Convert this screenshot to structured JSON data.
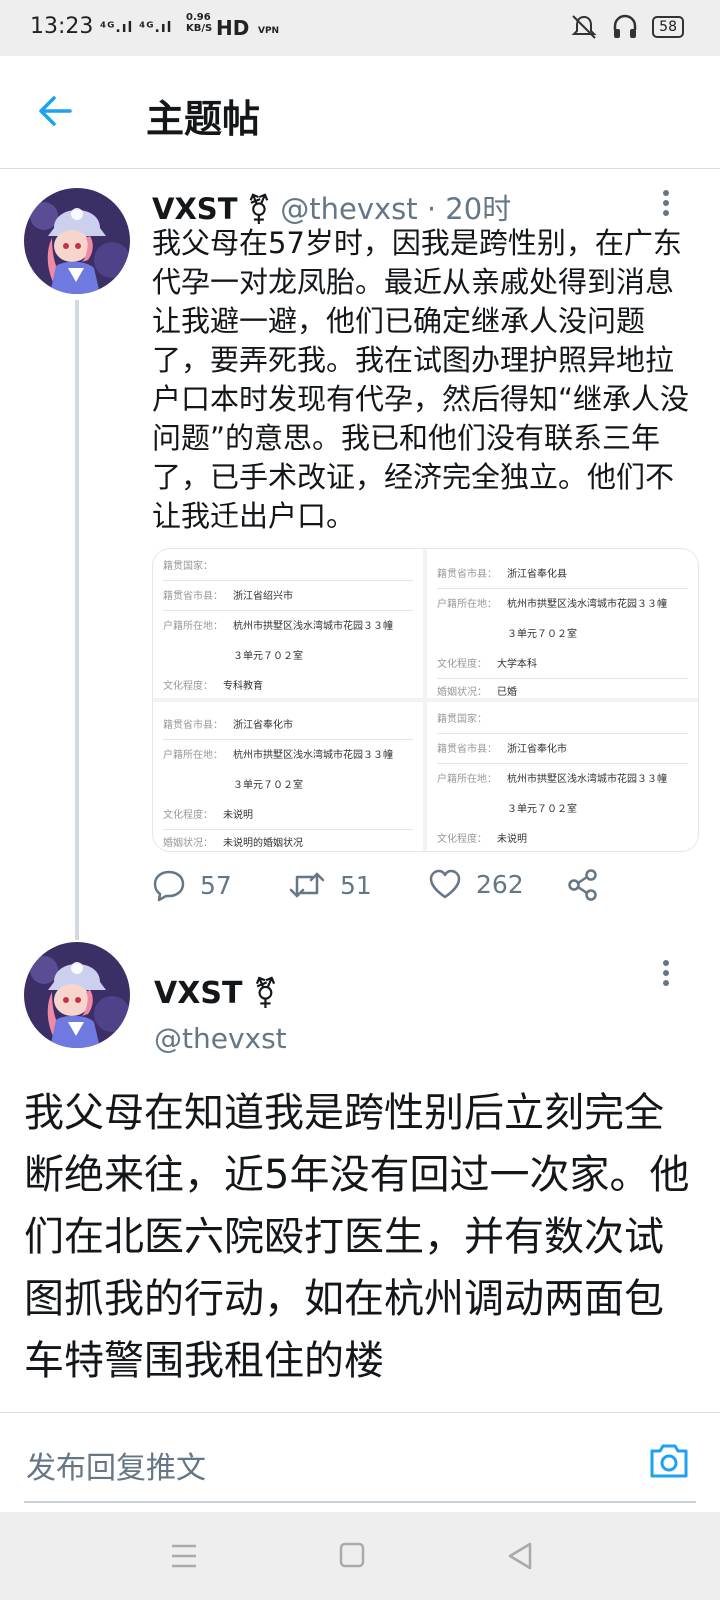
{
  "status_bar": {
    "time": "13:23",
    "network": "⁴ᴳ.ıl ⁴ᴳ.ıl",
    "speed_value": "0.96",
    "speed_unit": "KB/S",
    "hd": "HD",
    "vpn": "VPN",
    "battery": "58"
  },
  "header": {
    "title": "主题帖"
  },
  "tweet1": {
    "name": "VXST",
    "gender_symbol": "⚧",
    "handle": "@thevxst",
    "time": "· 20时",
    "text": "我父母在57岁时，因我是跨性别，在广东代孕一对龙凤胎。最近从亲戚处得到消息让我避一避，他们已确定继承人没问题了，要弄死我。我在试图办理护照异地拉户口本时发现有代孕，然后得知“继承人没问题”的意思。我已和他们没有联系三年了，已手术改证，经济完全独立。他们不让我迁出户口。",
    "images": [
      {
        "rows": [
          {
            "label": "籍贯国家：",
            "value": ""
          },
          {
            "label": "籍贯省市县：",
            "value": "浙江省绍兴市"
          },
          {
            "label": "户籍所在地：",
            "value": "杭州市拱墅区浅水湾城市花园３３幢"
          },
          {
            "label": "",
            "value": "３单元７０２室"
          },
          {
            "label": "文化程度：",
            "value": "专科教育"
          }
        ]
      },
      {
        "rows": [
          {
            "label": "籍贯省市县：",
            "value": "浙江省奉化县"
          },
          {
            "label": "户籍所在地：",
            "value": "杭州市拱墅区浅水湾城市花园３３幢"
          },
          {
            "label": "",
            "value": "３单元７０２室"
          },
          {
            "label": "文化程度：",
            "value": "大学本科"
          },
          {
            "label": "婚姻状况：",
            "value": "已婚"
          }
        ]
      },
      {
        "rows": [
          {
            "label": "籍贯省市县：",
            "value": "浙江省奉化市"
          },
          {
            "label": "户籍所在地：",
            "value": "杭州市拱墅区浅水湾城市花园３３幢"
          },
          {
            "label": "",
            "value": "３单元７０２室"
          },
          {
            "label": "文化程度：",
            "value": "未说明"
          },
          {
            "label": "婚姻状况：",
            "value": "未说明的婚姻状况"
          }
        ]
      },
      {
        "rows": [
          {
            "label": "籍贯国家：",
            "value": ""
          },
          {
            "label": "籍贯省市县：",
            "value": "浙江省奉化市"
          },
          {
            "label": "户籍所在地：",
            "value": "杭州市拱墅区浅水湾城市花园３３幢"
          },
          {
            "label": "",
            "value": "３单元７０２室"
          },
          {
            "label": "文化程度：",
            "value": "未说明"
          }
        ]
      }
    ],
    "replies": "57",
    "retweets": "51",
    "likes": "262"
  },
  "tweet2": {
    "name": "VXST",
    "gender_symbol": "⚧",
    "handle": "@thevxst",
    "text": "我父母在知道我是跨性别后立刻完全断绝来往，近5年没有回过一次家。他们在北医六院殴打医生，并有数次试图抓我的行动，如在杭州调动两面包车特警围我租住的楼"
  },
  "reply_bar": {
    "placeholder": "发布回复推文"
  },
  "colors": {
    "accent": "#1da1f2",
    "secondary_text": "#657786",
    "border": "#dadde1",
    "thread_line": "#cfd9de"
  },
  "icons": [
    "back-arrow-icon",
    "more-vert-icon",
    "reply-icon",
    "retweet-icon",
    "like-icon",
    "share-icon",
    "camera-icon",
    "menu-icon",
    "home-icon",
    "back-triangle-icon"
  ]
}
